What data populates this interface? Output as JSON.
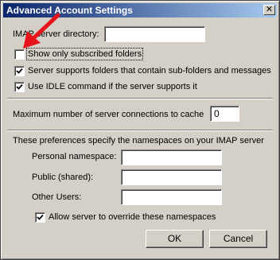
{
  "window": {
    "title": "Advanced Account Settings",
    "close_glyph": "✕"
  },
  "imap": {
    "directory_label": "IMAP server directory:",
    "directory_value": ""
  },
  "options": [
    {
      "label": "Show only subscribed folders",
      "checked": false
    },
    {
      "label": "Server supports folders that contain sub-folders and messages",
      "checked": true
    },
    {
      "label": "Use IDLE command if the server supports it",
      "checked": true
    }
  ],
  "connections": {
    "label": "Maximum number of server connections to cache",
    "value": "0"
  },
  "namespaces": {
    "intro": "These preferences specify the namespaces on your IMAP server",
    "personal_label": "Personal namespace:",
    "personal_value": "",
    "public_label": "Public (shared):",
    "public_value": "",
    "other_label": "Other Users:",
    "other_value": "",
    "override_label": "Allow server to override these namespaces",
    "override_checked": true
  },
  "buttons": {
    "ok": "OK",
    "cancel": "Cancel"
  },
  "annotation": {
    "arrow_color": "#e8141c"
  }
}
